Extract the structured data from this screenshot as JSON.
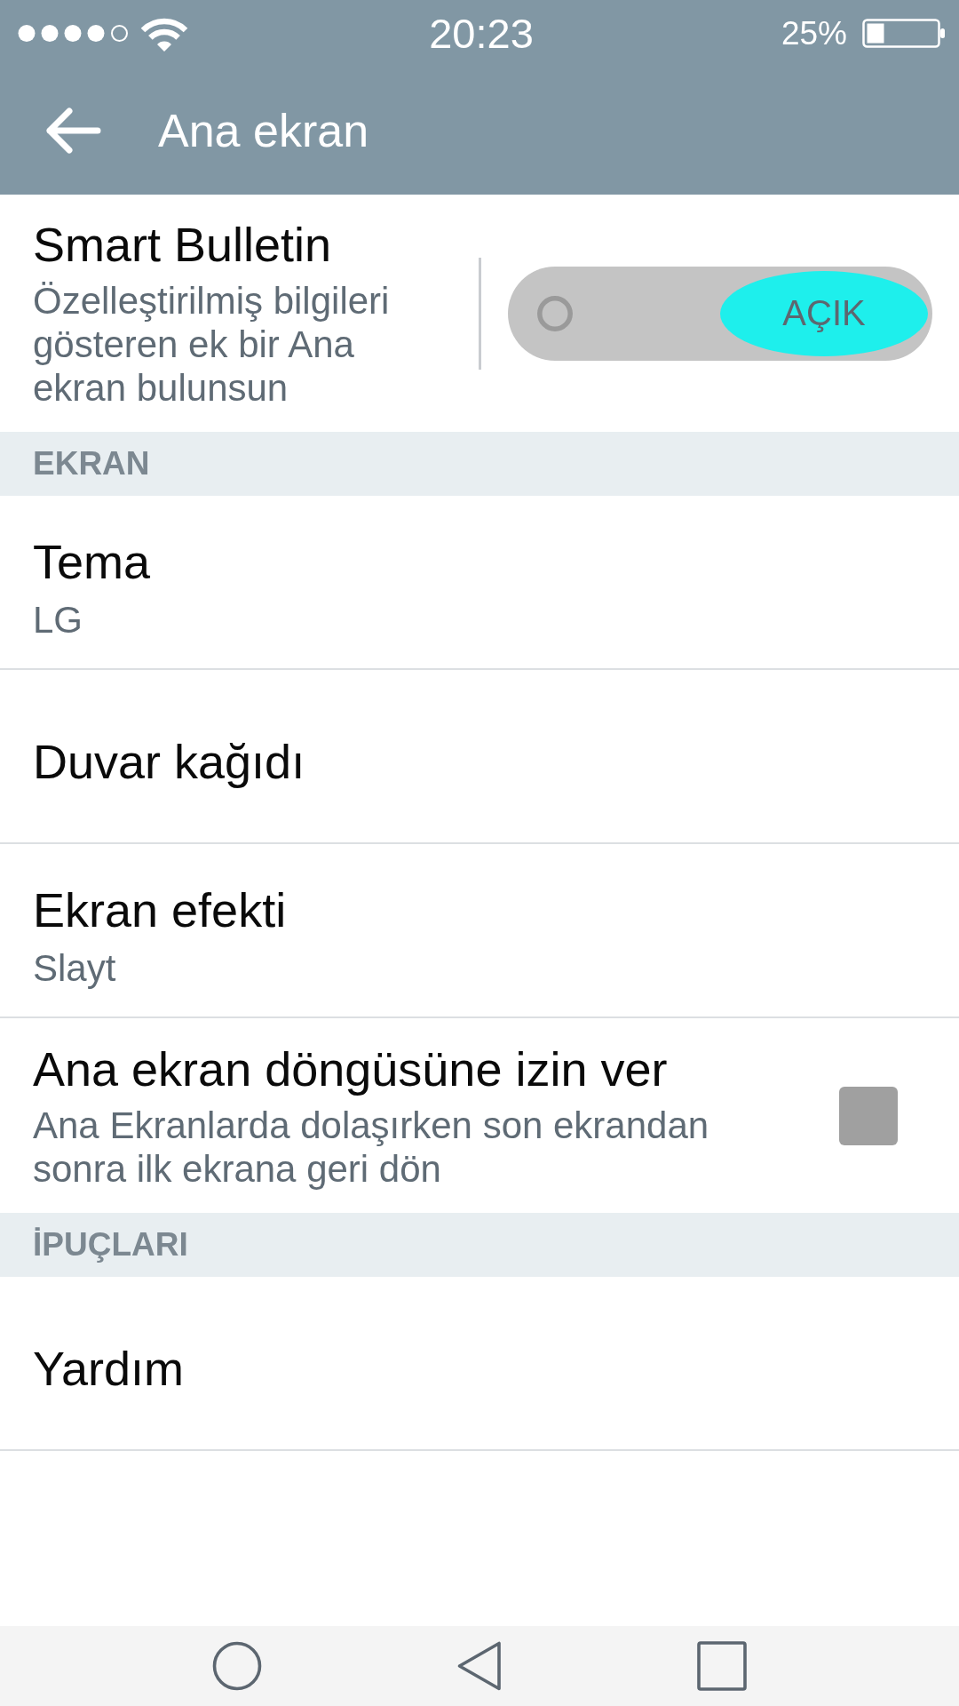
{
  "status_bar": {
    "time": "20:23",
    "battery": "25%"
  },
  "toolbar": {
    "title": "Ana ekran"
  },
  "settings": [
    {
      "kind": "switch",
      "title": "Smart Bulletin",
      "subtitle": "Özelleştirilmiş bilgileri gösteren ek bir Ana ekran bulunsun",
      "on": true,
      "label": "AÇIK"
    },
    {
      "kind": "header",
      "title": "EKRAN"
    },
    {
      "kind": "item",
      "title": "Tema",
      "subtitle": "LG"
    },
    {
      "kind": "item",
      "title": "Duvar kağıdı"
    },
    {
      "kind": "item",
      "title": "Ekran efekti",
      "subtitle": "Slayt"
    },
    {
      "kind": "checkbox",
      "title": "Ana ekran döngüsüne izin ver",
      "subtitle": "Ana Ekranlarda dolaşırken son ekrandan sonra ilk ekrana geri dön",
      "checked": false
    },
    {
      "kind": "header",
      "title": "İPUÇLARI"
    },
    {
      "kind": "item",
      "title": "Yardım"
    }
  ]
}
